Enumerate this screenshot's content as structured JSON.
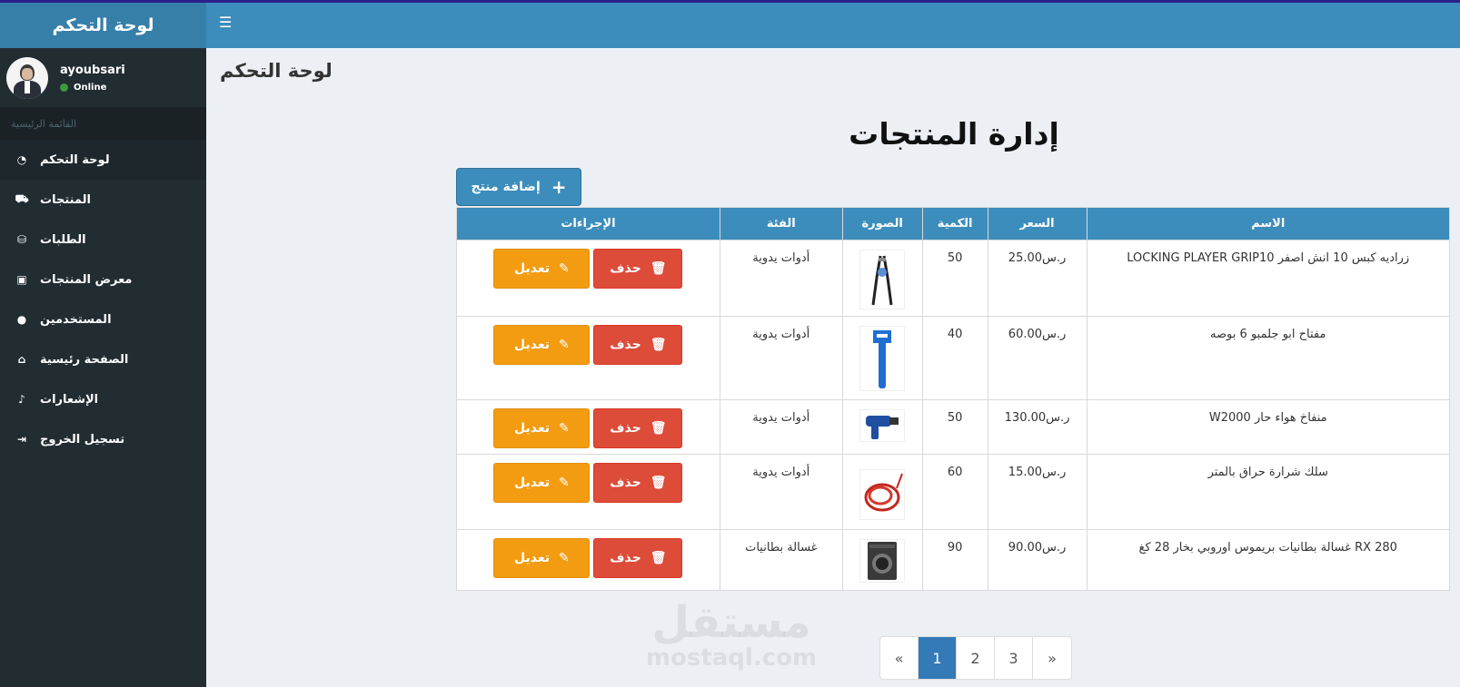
{
  "sidebar": {
    "logo": "لوحة التحكم",
    "user": {
      "name": "ayoubsari",
      "status": "Online"
    },
    "menu_header": "القائمة الرئيسية",
    "items": [
      {
        "label": "لوحة التحكم",
        "icon": "dashboard-icon",
        "glyph": "◔"
      },
      {
        "label": "المنتجات",
        "icon": "cart-icon",
        "glyph": "⛟"
      },
      {
        "label": "الطلبات",
        "icon": "orders-icon",
        "glyph": "⛁"
      },
      {
        "label": "معرض المنتجات",
        "icon": "image-icon",
        "glyph": "▣"
      },
      {
        "label": "المستخدمين",
        "icon": "user-icon",
        "glyph": "●"
      },
      {
        "label": "الصفحة رئيسية",
        "icon": "home-icon",
        "glyph": "⌂"
      },
      {
        "label": "الإشعارات",
        "icon": "bell-icon",
        "glyph": "♪"
      },
      {
        "label": "تسجيل الخروج",
        "icon": "logout-icon",
        "glyph": "⇥"
      }
    ]
  },
  "header": {
    "menu_icon": "☰"
  },
  "content": {
    "page_title": "لوحة التحكم",
    "section_title": "إدارة المنتجات",
    "add_button": "إضافة منتج",
    "table": {
      "headers": [
        "الإجراءات",
        "الفئة",
        "الصورة",
        "الكمية",
        "السعر",
        "الاسم"
      ],
      "edit_label": "تعديل",
      "delete_label": "حذف",
      "rows": [
        {
          "category": "أدوات يدوية",
          "qty": "50",
          "price": "ر.س25.00",
          "name": "LOCKING PLAYER GRIP10 زراديه كبس 10 انش اصفر",
          "image": "pliers"
        },
        {
          "category": "أدوات يدوية",
          "qty": "40",
          "price": "ر.س60.00",
          "name": "مفتاح ابو جلمبو 6 بوصه",
          "image": "wrench"
        },
        {
          "category": "أدوات يدوية",
          "qty": "50",
          "price": "ر.س130.00",
          "name": "Wمنفاخ هواء حار 2000",
          "image": "heatgun"
        },
        {
          "category": "أدوات يدوية",
          "qty": "60",
          "price": "ر.س15.00",
          "name": "سلك شرارة حراق بالمتر",
          "image": "cable"
        },
        {
          "category": "غسالة بطانيات",
          "qty": "90",
          "price": "ر.س90.00",
          "name": "غسالة بطانيات بريموس اوروبي بخار 28 كغ RX 280",
          "image": "washer"
        }
      ]
    },
    "pagination": [
      "«",
      "1",
      "2",
      "3",
      "»"
    ],
    "current_page": "1"
  },
  "watermark": {
    "ar": "مستقل",
    "en": "mostaql.com"
  },
  "colors": {
    "primary": "#3c8dbc",
    "edit": "#f39c12",
    "delete": "#dd4b39",
    "sidebar": "#222d32"
  }
}
